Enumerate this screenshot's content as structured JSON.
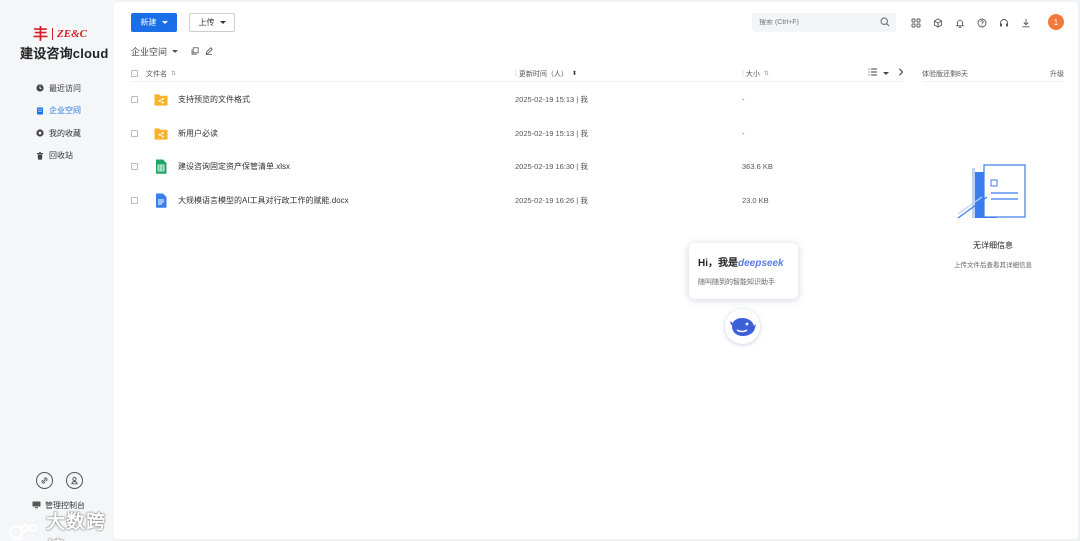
{
  "brand": {
    "mark": "丰",
    "company": "ZE&C",
    "title": "建设咨询cloud"
  },
  "sidebar": {
    "items": [
      {
        "label": "最近访问",
        "icon": "clock-icon"
      },
      {
        "label": "企业空间",
        "icon": "building-icon"
      },
      {
        "label": "我的收藏",
        "icon": "star-icon"
      },
      {
        "label": "回收站",
        "icon": "trash-icon"
      }
    ],
    "admin_label": "管理控制台",
    "watermark": "大数跨境"
  },
  "toolbar": {
    "new_label": "新建",
    "upload_label": "上传"
  },
  "search": {
    "placeholder": "搜索 (Ctrl+F)"
  },
  "user": {
    "avatar_text": "1"
  },
  "breadcrumb": {
    "current": "企业空间"
  },
  "table": {
    "headers": {
      "name": "文件名",
      "modified": "更新时间（人）",
      "size": "大小"
    },
    "rows": [
      {
        "name": "支持预览的文件格式",
        "type": "shared-folder",
        "modified": "2025-02-19 15:13 | 我",
        "size": "-"
      },
      {
        "name": "新用户必读",
        "type": "shared-folder",
        "modified": "2025-02-19 15:13 | 我",
        "size": "-"
      },
      {
        "name": "建设咨询固定资产保管清单.xlsx",
        "type": "xlsx",
        "modified": "2025-02-19 16:30 | 我",
        "size": "363.6 KB"
      },
      {
        "name": "大规模语言模型的AI工具对行政工作的赋能.docx",
        "type": "docx",
        "modified": "2025-02-19 16:26 | 我",
        "size": "23.0 KB"
      }
    ]
  },
  "details_panel": {
    "header_left": "体验版还剩8天",
    "header_right": "升级",
    "empty_title": "无详细信息",
    "empty_subtitle": "上传文件后查看其详细信息"
  },
  "assistant": {
    "greeting": "Hi，我是",
    "brand": "deepseek",
    "subtitle": "随叫随到的智能知识助手"
  },
  "colors": {
    "accent": "#1a6fe8",
    "folder": "#f7b32b",
    "xlsx": "#1fa463",
    "docx": "#3b7ded",
    "brand_red": "#d4202a",
    "avatar": "#f2793a"
  }
}
